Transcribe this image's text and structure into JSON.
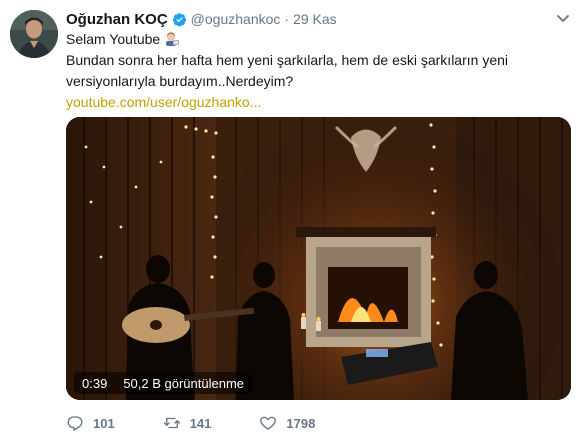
{
  "tweet": {
    "user": {
      "display_name": "Oğuzhan KOÇ",
      "handle": "@oguzhankoc",
      "verified_icon": "verified-badge-icon",
      "avatar_icon": "profile-avatar"
    },
    "separator": "·",
    "timestamp": "29 Kas",
    "caret_icon": "chevron-down-icon",
    "text": {
      "line1": "Selam Youtube",
      "line1_emoji": "man-technologist-emoji",
      "line2": "Bundan sonra her hafta hem yeni şarkılarla, hem de eski şarkıların yeni",
      "line3": "versiyonlarıyla burdayım..Nerdeyim?",
      "link": "youtube.com/user/oguzhanko..."
    },
    "media": {
      "duration": "0:39",
      "views": "50,2 B görüntülenme",
      "thumbnail": "video-thumbnail-musicians-by-fireplace"
    },
    "actions": {
      "reply_icon": "reply-icon",
      "reply_count": "101",
      "retweet_icon": "retweet-icon",
      "retweet_count": "141",
      "like_icon": "heart-icon",
      "like_count": "1798"
    },
    "colors": {
      "link": "#c5a100",
      "muted": "#657786",
      "verified": "#1da1f2",
      "text": "#14171a"
    }
  }
}
